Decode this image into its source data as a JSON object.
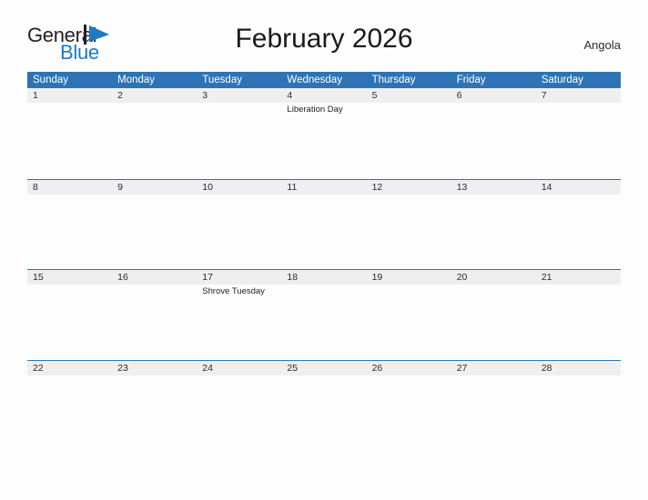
{
  "logo": {
    "word_one": "General",
    "word_two": "Blue",
    "triangle_color": "#1f7ac4",
    "text_color": "#231f20"
  },
  "header": {
    "title": "February 2026",
    "region": "Angola"
  },
  "theme": {
    "accent": "#2e74b5",
    "header_text": "#ffffff",
    "daynum_band": "#efefef",
    "page_background": "#fdfdfd"
  },
  "calendar": {
    "weekdays": [
      "Sunday",
      "Monday",
      "Tuesday",
      "Wednesday",
      "Thursday",
      "Friday",
      "Saturday"
    ],
    "weeks": [
      {
        "days": [
          {
            "num": "1",
            "events": []
          },
          {
            "num": "2",
            "events": []
          },
          {
            "num": "3",
            "events": []
          },
          {
            "num": "4",
            "events": [
              "Liberation Day"
            ]
          },
          {
            "num": "5",
            "events": []
          },
          {
            "num": "6",
            "events": []
          },
          {
            "num": "7",
            "events": []
          }
        ]
      },
      {
        "days": [
          {
            "num": "8",
            "events": []
          },
          {
            "num": "9",
            "events": []
          },
          {
            "num": "10",
            "events": []
          },
          {
            "num": "11",
            "events": []
          },
          {
            "num": "12",
            "events": []
          },
          {
            "num": "13",
            "events": []
          },
          {
            "num": "14",
            "events": []
          }
        ]
      },
      {
        "days": [
          {
            "num": "15",
            "events": []
          },
          {
            "num": "16",
            "events": []
          },
          {
            "num": "17",
            "events": [
              "Shrove Tuesday"
            ]
          },
          {
            "num": "18",
            "events": []
          },
          {
            "num": "19",
            "events": []
          },
          {
            "num": "20",
            "events": []
          },
          {
            "num": "21",
            "events": []
          }
        ]
      },
      {
        "days": [
          {
            "num": "22",
            "events": []
          },
          {
            "num": "23",
            "events": []
          },
          {
            "num": "24",
            "events": []
          },
          {
            "num": "25",
            "events": []
          },
          {
            "num": "26",
            "events": []
          },
          {
            "num": "27",
            "events": []
          },
          {
            "num": "28",
            "events": []
          }
        ]
      }
    ]
  }
}
